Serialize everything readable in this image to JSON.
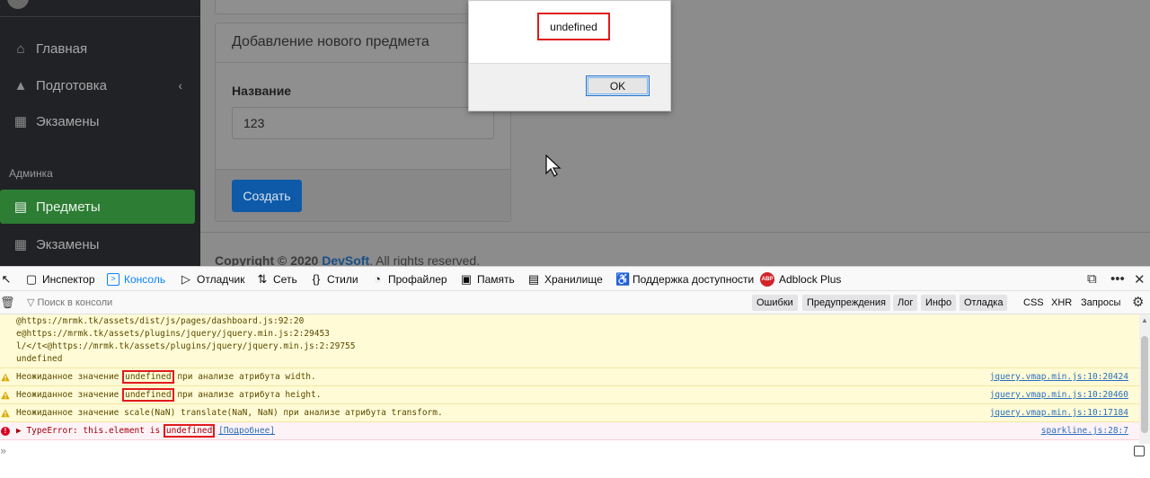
{
  "sidebar": {
    "items": [
      {
        "label": "Главная",
        "icon": "home-icon"
      },
      {
        "label": "Подготовка",
        "icon": "graduation-cap-icon"
      },
      {
        "label": "Экзамены",
        "icon": "calendar-icon"
      }
    ],
    "section_header": "Админка",
    "admin_items": [
      {
        "label": "Предметы",
        "icon": "book-icon",
        "active": true
      },
      {
        "label": "Экзамены",
        "icon": "calendar-icon"
      }
    ]
  },
  "form": {
    "title": "Добавление нового предмета",
    "name_label": "Название",
    "name_value": "123",
    "submit_label": "Создать"
  },
  "footer": {
    "copyright": "Copyright © 2020 ",
    "brand": "DevSoft",
    "rest": ". All rights reserved."
  },
  "alert": {
    "message": "undefined",
    "ok_label": "OK"
  },
  "devtools": {
    "tabs": [
      {
        "label": "Инспектор",
        "icon": "inspector-icon"
      },
      {
        "label": "Консоль",
        "icon": "console-icon",
        "active": true
      },
      {
        "label": "Отладчик",
        "icon": "debugger-icon"
      },
      {
        "label": "Сеть",
        "icon": "network-icon"
      },
      {
        "label": "Стили",
        "icon": "style-editor-icon"
      },
      {
        "label": "Профайлер",
        "icon": "profiler-icon"
      },
      {
        "label": "Память",
        "icon": "memory-icon"
      },
      {
        "label": "Хранилище",
        "icon": "storage-icon"
      },
      {
        "label": "Поддержка доступности",
        "icon": "accessibility-icon"
      },
      {
        "label": "Adblock Plus",
        "icon": "adblock-icon"
      }
    ],
    "filter_placeholder": "Поиск в консоли",
    "levels": [
      "Ошибки",
      "Предупреждения",
      "Лог",
      "Инфо",
      "Отладка"
    ],
    "extra_filters": [
      "CSS",
      "XHR",
      "Запросы"
    ],
    "stack": [
      "@https://mrmk.tk/assets/dist/js/pages/dashboard.js:92:20",
      "e@https://mrmk.tk/assets/plugins/jquery/jquery.min.js:2:29453",
      "l/</t<@https://mrmk.tk/assets/plugins/jquery/jquery.min.js:2:29755",
      " undefined"
    ],
    "messages": [
      {
        "type": "warn",
        "pre": "Неожиданное значение ",
        "hl": "undefined",
        "post": " при анализе атрибута width.",
        "source": "jquery.vmap.min.js:10:20424"
      },
      {
        "type": "warn",
        "pre": "Неожиданное значение ",
        "hl": "undefined",
        "post": " при анализе атрибута height.",
        "source": "jquery.vmap.min.js:10:20460"
      },
      {
        "type": "warn",
        "pre": "Неожиданное значение scale(NaN) translate(NaN, NaN) при анализе атрибута transform.",
        "hl": "",
        "post": "",
        "source": "jquery.vmap.min.js:10:17184"
      },
      {
        "type": "error",
        "pre": "TypeError: this.element is ",
        "hl": "undefined",
        "post": " ",
        "more": "[Подробнее]",
        "source": "sparkline.js:28:7"
      }
    ],
    "prompt": "»"
  },
  "colors": {
    "accent_active": "#2d7d34",
    "button_primary": "#0e5aa8",
    "highlight_box": "#e01b1b",
    "devtools_active_tab": "#0a84ff"
  }
}
